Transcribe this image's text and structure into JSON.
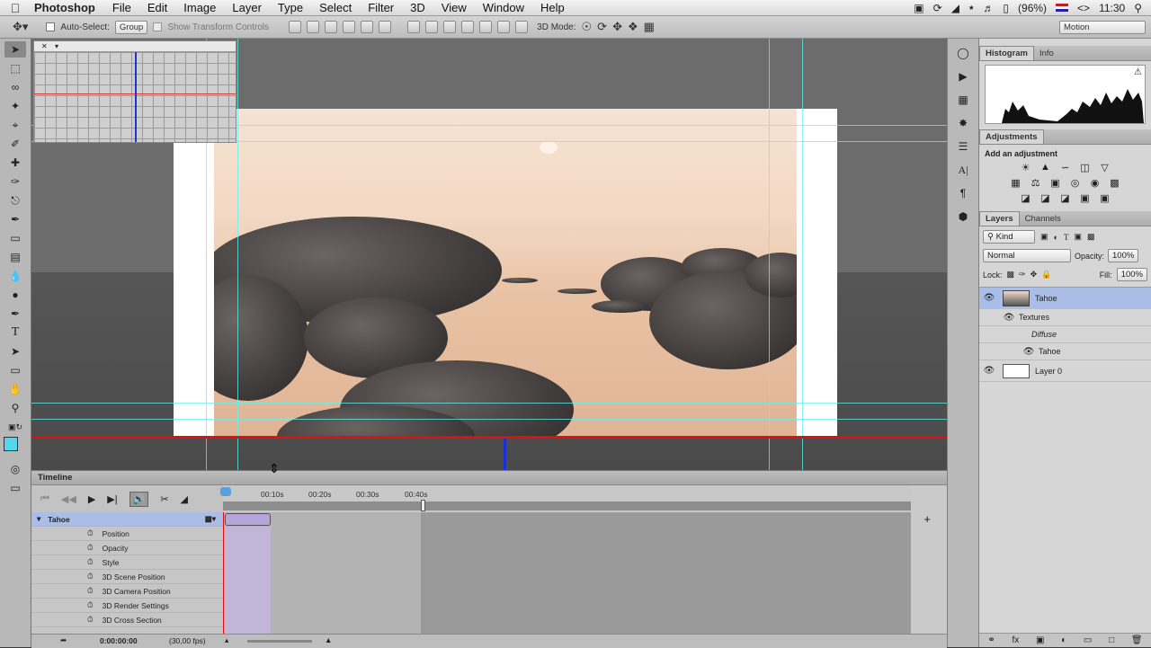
{
  "menubar": {
    "app_name": "Photoshop",
    "menus": [
      "File",
      "Edit",
      "Image",
      "Layer",
      "Type",
      "Select",
      "Filter",
      "3D",
      "View",
      "Window",
      "Help"
    ],
    "battery": "(96%)",
    "keyboard": "<>",
    "clock": "11:30"
  },
  "options": {
    "auto_select_label": "Auto-Select:",
    "auto_select_value": "Group",
    "transform_label": "Show Transform Controls",
    "mode_label": "3D Mode:",
    "workspace": "Motion"
  },
  "histogram_panel": {
    "tabs": [
      "Histogram",
      "Info"
    ],
    "warning_icon": "warning-icon"
  },
  "adjustments_panel": {
    "tab": "Adjustments",
    "prompt": "Add an adjustment"
  },
  "layers_panel": {
    "tabs": [
      "Layers",
      "Channels"
    ],
    "filter": "Kind",
    "blend_mode": "Normal",
    "opacity_label": "Opacity:",
    "opacity": "100%",
    "lock_label": "Lock:",
    "fill_label": "Fill:",
    "fill": "100%",
    "layers": [
      {
        "name": "Tahoe",
        "sub": [
          "Textures",
          "Diffuse",
          "Tahoe"
        ]
      },
      {
        "name": "Layer 0"
      }
    ]
  },
  "timeline": {
    "title": "Timeline",
    "ticks": [
      "00:10s",
      "00:20s",
      "00:30s",
      "00:40s"
    ],
    "track_name": "Tahoe",
    "properties": [
      "Position",
      "Opacity",
      "Style",
      "3D Scene Position",
      "3D Camera Position",
      "3D Render Settings",
      "3D Cross Section"
    ],
    "current_time": "0:00:00:00",
    "fps": "(30,00 fps)"
  },
  "colors": {
    "accent_layer": "#a9bde6",
    "guide": "#5ff3ee",
    "red_line": "#dd1111",
    "blue_line": "#1a2fd8"
  }
}
